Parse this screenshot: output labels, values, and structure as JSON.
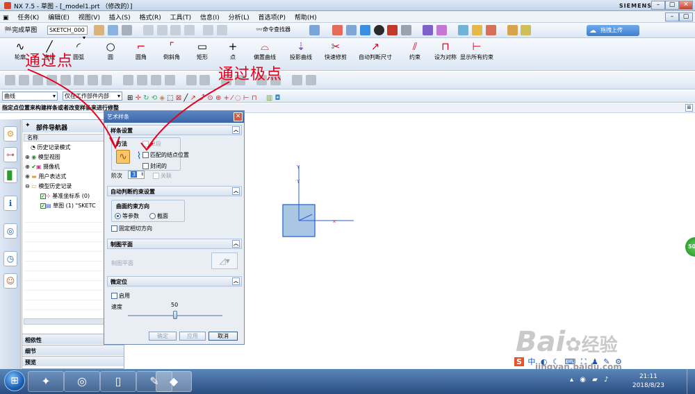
{
  "window": {
    "title": "NX 7.5 - 草图 - [_model1.prt （修改的）]",
    "brand": "SIEMENS",
    "min": "–",
    "restore": "▢",
    "close": "✕"
  },
  "menu": {
    "items": [
      "任务(K)",
      "编辑(E)",
      "视图(V)",
      "插入(S)",
      "格式(R)",
      "工具(T)",
      "信息(I)",
      "分析(L)",
      "首选项(P)",
      "帮助(H)"
    ]
  },
  "upload": {
    "label": "拖拽上传"
  },
  "toolbar1": {
    "finish_sketch": "完成草图",
    "sketch_combo": "SKETCH_000",
    "command_finder": "命令查找器"
  },
  "toolbar2": {
    "items": [
      "轮廓",
      "直线",
      "圆弧",
      "圆",
      "圆角",
      "倒斜角",
      "矩形",
      "点",
      "偏置曲线",
      "投影曲线",
      "快速修剪",
      "自动判断尺寸",
      "约束",
      "设为对称",
      "显示所有约束"
    ]
  },
  "filterbar": {
    "curve_combo": "曲线",
    "scope_combo": "仅在工作部件内部"
  },
  "cue": {
    "text": "指定点位置来构建样条或者改变样条来进行修整"
  },
  "navigator": {
    "title": "部件导航器",
    "col_name": "名称",
    "rows": [
      "历史记录模式",
      "模型视图",
      "摄像机",
      "用户表达式",
      "模型历史记录",
      "基准坐标系 (0)",
      "草图 (1) \"SKETC"
    ],
    "footers": [
      "相依性",
      "细节",
      "预览"
    ]
  },
  "dialog": {
    "title": "艺术样条",
    "sec_spline": "样条设置",
    "method_label": "方法",
    "opt_single": "单段",
    "opt_match_knot": "匹配的结点位置",
    "opt_closed": "封闭的",
    "degree_label": "阶次",
    "degree_value": "3",
    "opt_associative": "关联",
    "sec_auto": "自动判断约束设置",
    "surface_dir_label": "曲面约束方向",
    "radio_iso": "等参数",
    "radio_section": "截面",
    "opt_fixed_tangent": "固定相切方向",
    "sec_plane": "制图平面",
    "plane_label": "制图平面",
    "sec_fine": "微定位",
    "opt_enable": "启用",
    "speed_label": "速度",
    "speed_value": "50",
    "speed_level": 50,
    "btn_ok": "确定",
    "btn_apply": "应用",
    "btn_cancel": "取消"
  },
  "annotations": {
    "through_points": "通过点",
    "through_poles": "通过极点",
    "color": "#e3001b"
  },
  "axes": {
    "x": "x",
    "y": "Y"
  },
  "side_badge": "50",
  "watermark": {
    "brand": "Bai",
    "brand2": "经验",
    "url": "jingyan.baidu.com"
  },
  "taskbar": {
    "time": "21:11",
    "date": "2018/8/23"
  }
}
